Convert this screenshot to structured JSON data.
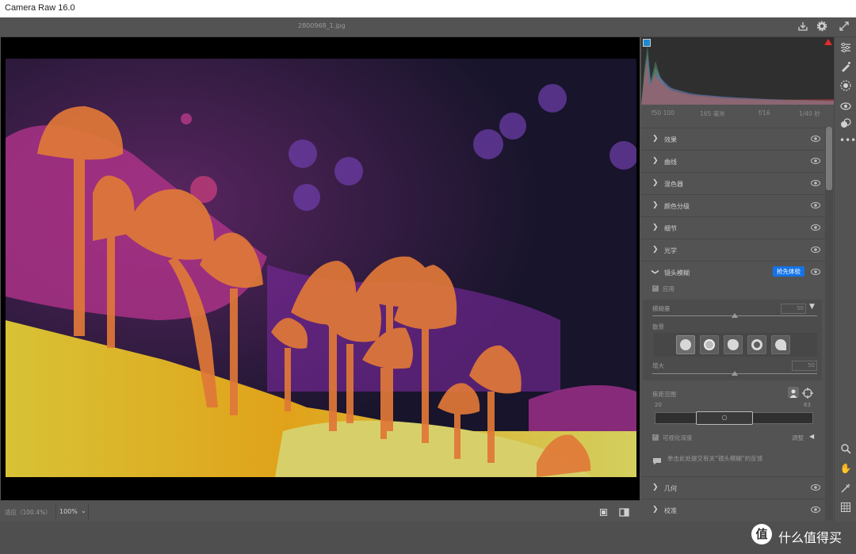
{
  "window": {
    "title": "Camera Raw 16.0"
  },
  "topbar": {
    "filename": "2800968_1.jpg"
  },
  "histogram": {
    "exif": [
      "f50 100",
      "165 毫米",
      "f/16",
      "1/40 秒"
    ]
  },
  "panels": [
    {
      "label": "效果",
      "expanded": false
    },
    {
      "label": "曲线",
      "expanded": false
    },
    {
      "label": "混色器",
      "expanded": false
    },
    {
      "label": "颜色分级",
      "expanded": false
    },
    {
      "label": "细节",
      "expanded": false
    },
    {
      "label": "光学",
      "expanded": false
    },
    {
      "label": "镜头模糊",
      "expanded": true,
      "badge": "抢先体验"
    }
  ],
  "lens_blur": {
    "apply_label": "应用",
    "amount_label": "模糊量",
    "amount_value": "50",
    "amount_fraction": 0.5,
    "bokeh_label": "散景",
    "boost_label": "增大",
    "boost_value": "50",
    "boost_fraction": 0.5,
    "focus_range_label": "焦距范围",
    "focus_min": "20",
    "focus_max": "63",
    "visualize_label": "可视化深度",
    "refine_label": "调整",
    "feedback_text": "单击此处提交有关“镜头模糊”的反馈"
  },
  "bottom_panels": [
    "几何",
    "校准"
  ],
  "bottombar": {
    "zoom_label": "适应（100.4%）",
    "zoom_value": "100%"
  },
  "watermark": {
    "glyph": "值",
    "text": "什么值得买"
  }
}
